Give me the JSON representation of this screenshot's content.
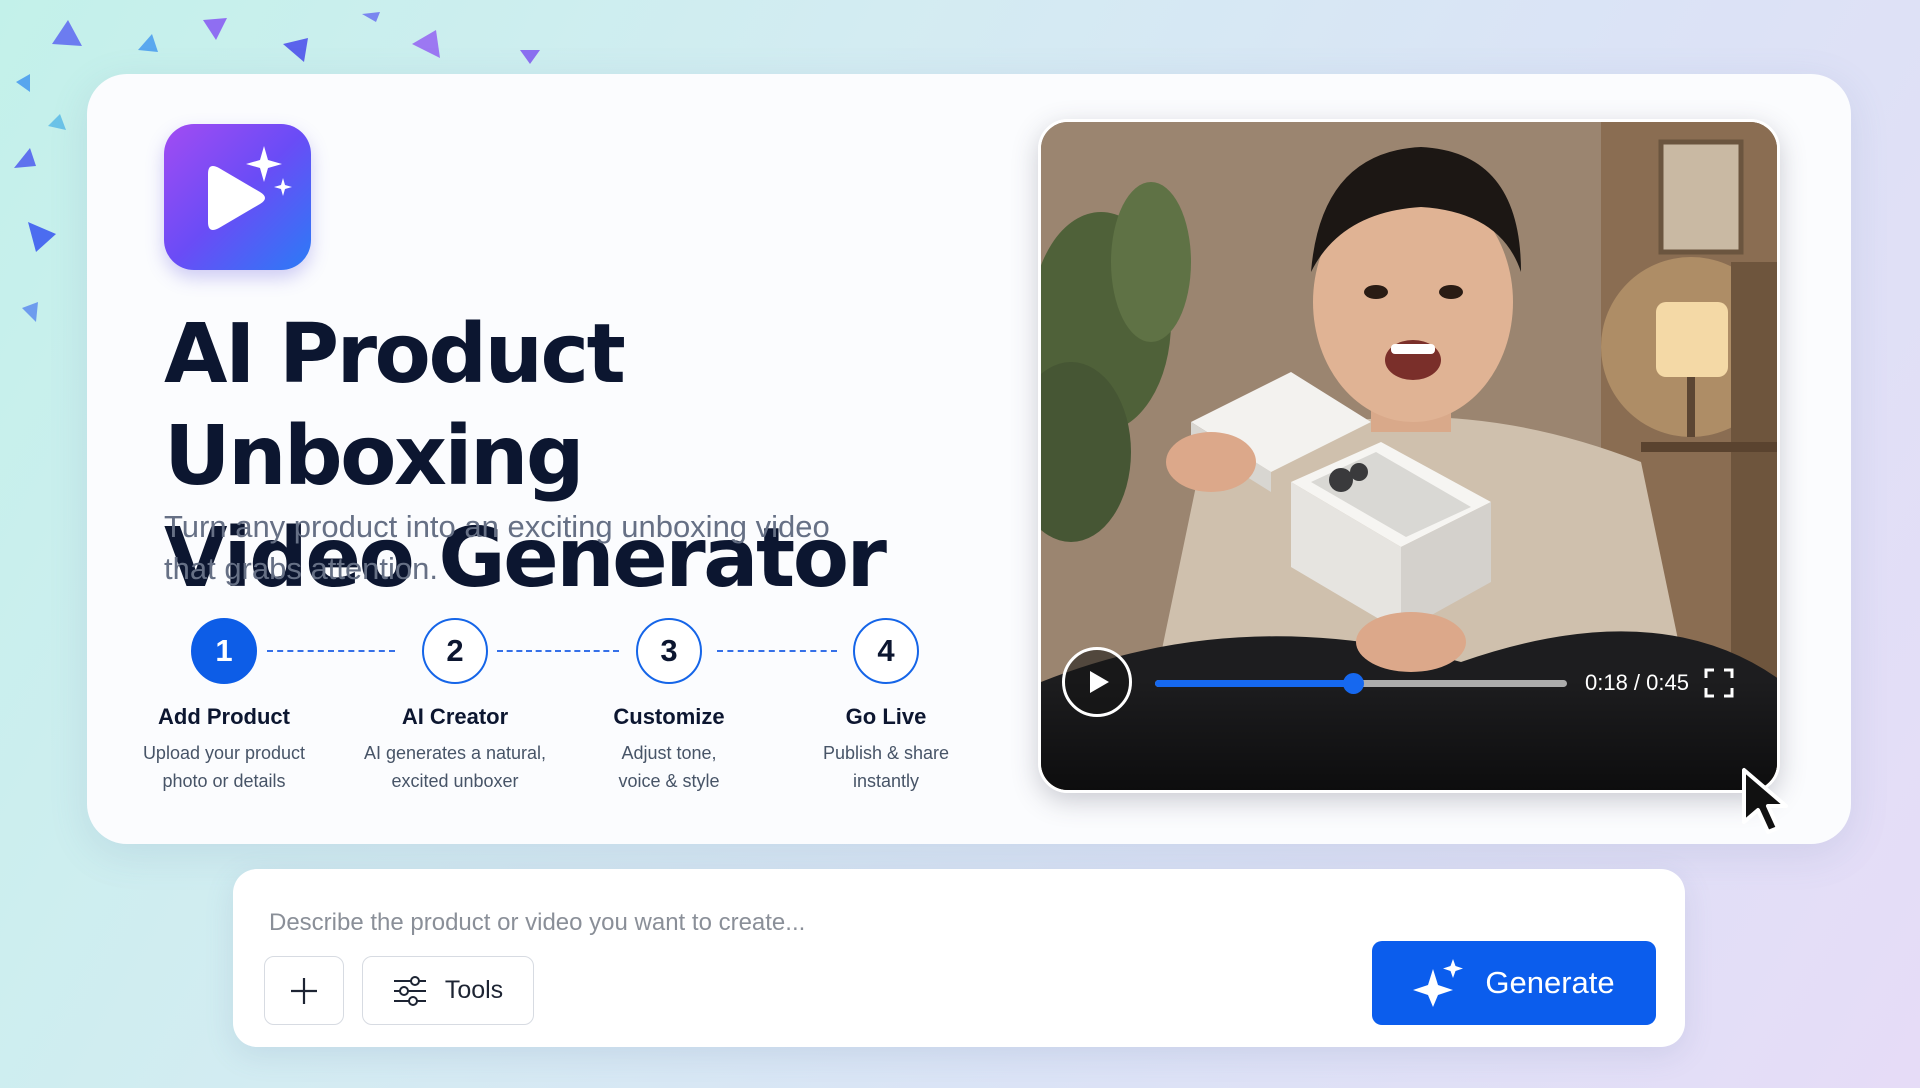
{
  "app": {
    "logo_icon": "play-sparkle-icon",
    "title_line1": "AI Product Unboxing",
    "title_line2": "Video Generator",
    "subtitle_line1": "Turn any product into an exciting unboxing video",
    "subtitle_line2": "that grabs attention."
  },
  "steps": [
    {
      "number": "1",
      "title": "Add Product",
      "desc_line1": "Upload your product",
      "desc_line2": "photo or details",
      "active": true
    },
    {
      "number": "2",
      "title": "AI Creator",
      "desc_line1": "AI generates a natural,",
      "desc_line2": "excited unboxer",
      "active": false
    },
    {
      "number": "3",
      "title": "Customize",
      "desc_line1": "Adjust tone,",
      "desc_line2": "voice & style",
      "active": false
    },
    {
      "number": "4",
      "title": "Go Live",
      "desc_line1": "Publish & share",
      "desc_line2": "instantly",
      "active": false
    }
  ],
  "video": {
    "time_display": "0:18 / 0:45",
    "progress_fraction": 0.48,
    "play_icon": "play-icon",
    "fullscreen_icon": "fullscreen-icon"
  },
  "prompt": {
    "placeholder": "Describe the product or video you want to create...",
    "add_icon": "plus-icon",
    "tools_label": "Tools",
    "tools_icon": "sliders-icon",
    "generate_label": "Generate",
    "generate_icon": "sparkle-icon"
  },
  "colors": {
    "accent": "#0b5ded",
    "title": "#0c1630",
    "subtitle": "#667085"
  }
}
